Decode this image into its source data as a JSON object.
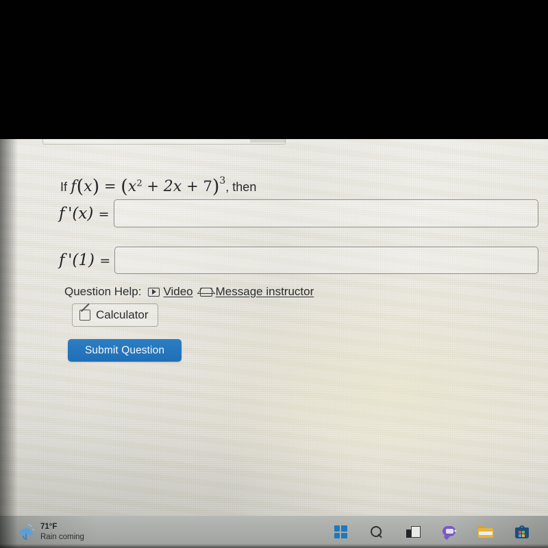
{
  "screen": {
    "black_bar_present": true
  },
  "question": {
    "prompt_prefix": "If",
    "function_name": "f",
    "variable": "x",
    "expression_inner": "x² + 2x + 7",
    "outer_exponent": "3",
    "prompt_suffix": ", then",
    "equation_text": "If f(x) = (x² + 2x + 7)³, then"
  },
  "answers": [
    {
      "label": "f'(x)",
      "label_plain": "f'(x) =",
      "value": "",
      "placeholder": ""
    },
    {
      "label": "f'(1)",
      "label_plain": "f'(1) =",
      "value": "",
      "placeholder": ""
    }
  ],
  "help": {
    "label": "Question Help:",
    "links": [
      {
        "text": "Video",
        "icon": "play-icon"
      },
      {
        "text": "Message instructor",
        "icon": "envelope-icon"
      }
    ],
    "calculator_label": "Calculator",
    "calculator_icon": "calculator-icon"
  },
  "submit": {
    "label": "Submit Question",
    "color": "#2574b8"
  },
  "taskbar": {
    "weather": {
      "temperature": "71°F",
      "condition": "Rain coming",
      "icon": "rain-umbrella-icon"
    },
    "items": [
      {
        "name": "start-button",
        "icon": "windows-logo-icon",
        "color": "#1d79c0"
      },
      {
        "name": "search-button",
        "icon": "search-icon"
      },
      {
        "name": "task-view-button",
        "icon": "task-view-icon"
      },
      {
        "name": "chat-button",
        "icon": "chat-video-icon",
        "color": "#7b57c9"
      },
      {
        "name": "file-explorer-button",
        "icon": "folder-icon",
        "color": "#e8b537"
      },
      {
        "name": "microsoft-store-button",
        "icon": "store-bag-icon",
        "color": "#1f4e79"
      }
    ]
  }
}
